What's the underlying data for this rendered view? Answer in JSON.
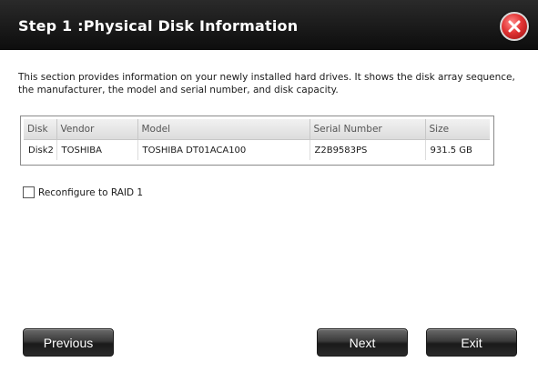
{
  "dialog": {
    "title": "Step 1 :Physical Disk Information",
    "description": "This section provides information on your newly installed hard drives. It shows the disk array sequence, the manufacturer, the model and serial number, and disk capacity."
  },
  "table": {
    "headers": [
      "Disk",
      "Vendor",
      "Model",
      "Serial Number",
      "Size"
    ],
    "rows": [
      [
        "Disk2",
        "TOSHIBA",
        "TOSHIBA DT01ACA100",
        "Z2B9583PS",
        "931.5 GB"
      ]
    ]
  },
  "options": {
    "reconfigure_label": "Reconfigure to RAID 1",
    "reconfigure_checked": false
  },
  "buttons": {
    "previous": "Previous",
    "next": "Next",
    "exit": "Exit"
  },
  "icons": {
    "close": "close-icon"
  },
  "colors": {
    "titlebar": "#1a1a1a",
    "close_button": "#e23434"
  }
}
